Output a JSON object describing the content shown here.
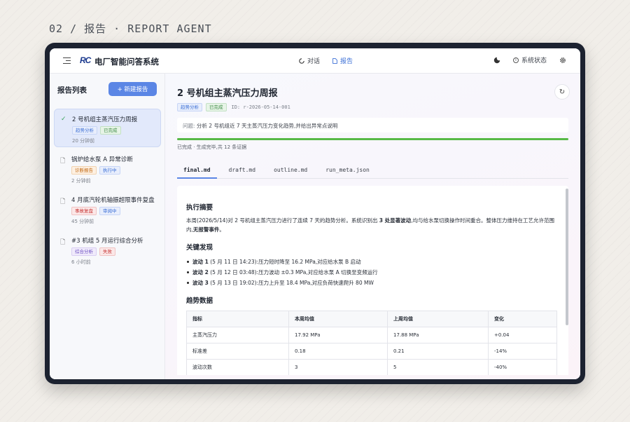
{
  "caption": "02 / 报告 · REPORT AGENT",
  "app": {
    "logo": "RC",
    "title": "电厂智能问答系统"
  },
  "nav": {
    "tabs": [
      {
        "label": "对话",
        "active": false
      },
      {
        "label": "报告",
        "active": true
      }
    ],
    "status_label": "系统状态"
  },
  "sidebar": {
    "heading": "报告列表",
    "new_button": "+ 新建报告",
    "items": [
      {
        "title": "2 号机组主蒸汽压力周报",
        "tags": [
          "趋势分析",
          "已完成"
        ],
        "time": "20 分钟前",
        "active": true
      },
      {
        "title": "锅炉给水泵 A 异常诊断",
        "tags": [
          "诊断报告",
          "执行中"
        ],
        "time": "2 分钟前",
        "active": false
      },
      {
        "title": "4 月底汽轮机轴振超限事件复盘",
        "tags": [
          "事故复盘",
          "审阅中"
        ],
        "time": "45 分钟前",
        "active": false
      },
      {
        "title": "#3 机组 5 月运行综合分析",
        "tags": [
          "综合分析",
          "失败"
        ],
        "time": "6 小时前",
        "active": false
      }
    ]
  },
  "report": {
    "title": "2 号机组主蒸汽压力周报",
    "tag_type": "趋势分析",
    "tag_status": "已完成",
    "id_text": "ID: r-2026-05-14-001",
    "question_label": "问题",
    "question": "分析 2 号机组近 7 天主蒸汽压力变化趋势,并给出异常点说明",
    "progress": 1.0,
    "progress_text": "已完成 · 生成完毕,共 12 条证据",
    "file_tabs": [
      "final.md",
      "draft.md",
      "outline.md",
      "run_meta.json"
    ],
    "active_file_tab": 0,
    "summary_heading": "执行摘要",
    "summary_pre": "本周(2026/5/14)对 2 号机组主蒸汽压力进行了连续 7 天的趋势分析。系统识别出 ",
    "summary_bold": "3 处显著波动",
    "summary_mid": ",均与给水泵切换操作时间重合。整体压力维持在工艺允许范围内,",
    "summary_bold2": "无报警事件",
    "summary_end": "。",
    "findings_heading": "关键发现",
    "findings": [
      {
        "label": "波动 1",
        "text": " (5 月 11 日 14:23):压力短时降至 16.2 MPa,对应给水泵 B 启动"
      },
      {
        "label": "波动 2",
        "text": " (5 月 12 日 03:48):压力波动 ±0.3 MPa,对应给水泵 A 切换至变频运行"
      },
      {
        "label": "波动 3",
        "text": " (5 月 13 日 19:02):压力上升至 18.4 MPa,对应负荷快速爬升 80 MW"
      }
    ],
    "trend_heading": "趋势数据",
    "table": {
      "headers": [
        "指标",
        "本周均值",
        "上周均值",
        "变化"
      ],
      "rows": [
        [
          "主蒸汽压力",
          "17.92 MPa",
          "17.88 MPa",
          "+0.04"
        ],
        [
          "标准差",
          "0.18",
          "0.21",
          "-14%"
        ],
        [
          "波动次数",
          "3",
          "5",
          "-40%"
        ]
      ]
    }
  }
}
